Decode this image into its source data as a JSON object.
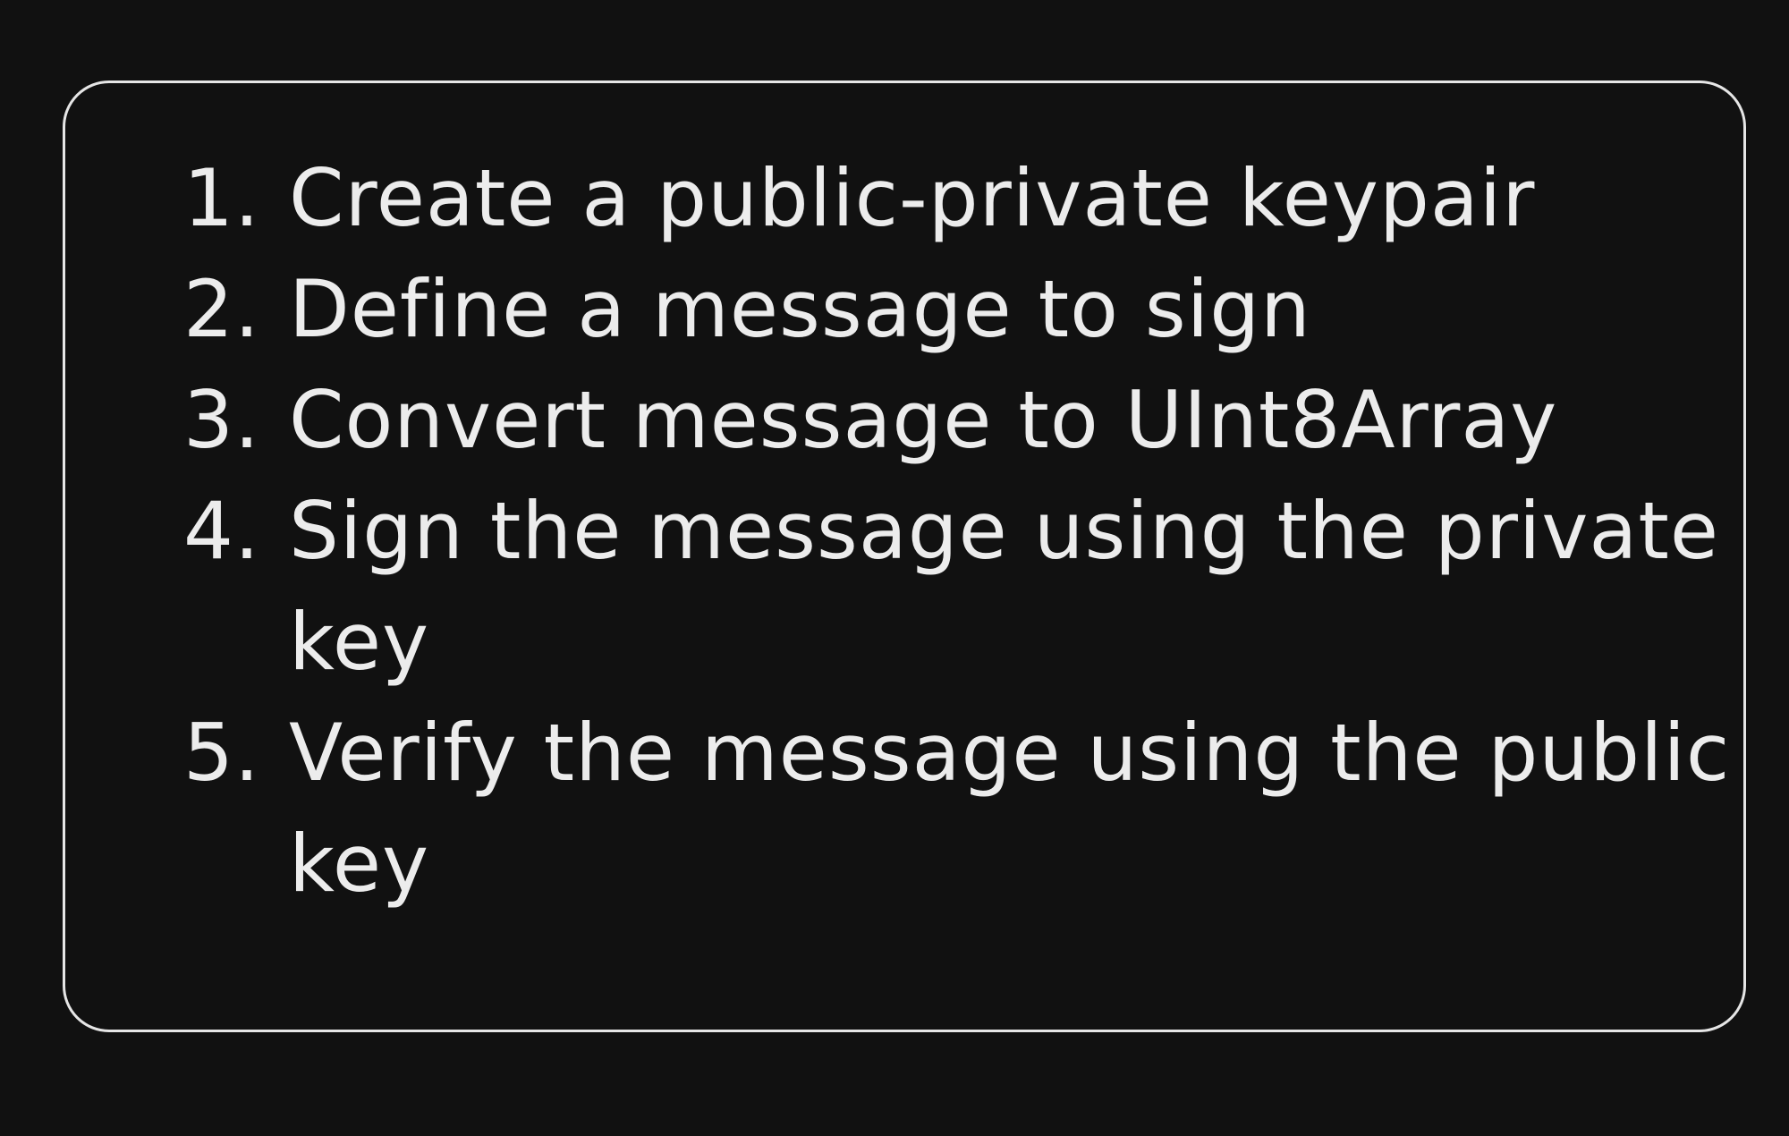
{
  "steps": [
    {
      "number": "1.",
      "text": "Create a public-private keypair"
    },
    {
      "number": "2.",
      "text": "Define a message to sign"
    },
    {
      "number": "3.",
      "text": "Convert message to UInt8Array"
    },
    {
      "number": "4.",
      "text": "Sign the message using the private key"
    },
    {
      "number": "5.",
      "text": "Verify the message using the public key"
    }
  ],
  "colors": {
    "background": "#111111",
    "text": "#ececec",
    "frame": "#e6e6e6"
  }
}
